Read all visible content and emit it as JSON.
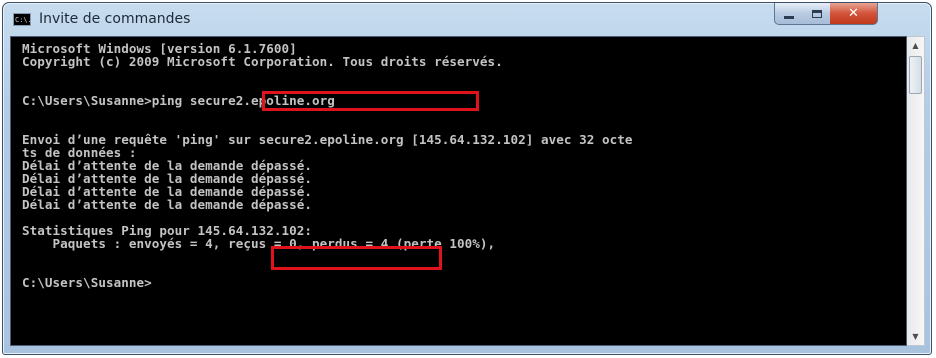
{
  "window": {
    "title": "Invite de commandes",
    "icon_text": "C:\\.",
    "icon": "cmd-icon",
    "controls": {
      "minimize_icon": "minimize-icon",
      "maximize_icon": "maximize-icon",
      "close_icon": "close-icon",
      "close_glyph": "✕"
    }
  },
  "console": {
    "lines": [
      "Microsoft Windows [version 6.1.7600]",
      "Copyright (c) 2009 Microsoft Corporation. Tous droits réservés.",
      "",
      "C:\\Users\\Susanne>ping secure2.epoline.org",
      "",
      "Envoi d’une requête 'ping' sur secure2.epoline.org [145.64.132.102] avec 32 octe",
      "ts de données :",
      "Délai d’attente de la demande dépassé.",
      "Délai d’attente de la demande dépassé.",
      "Délai d’attente de la demande dépassé.",
      "Délai d’attente de la demande dépassé.",
      "",
      "Statistiques Ping pour 145.64.132.102:",
      "    Paquets : envoyés = 4, reçus = 0, perdus = 4 (perte 100%),",
      "",
      "C:\\Users\\Susanne>"
    ],
    "text_color": "#c3c3c3",
    "background_color": "#000000",
    "highlight_color": "#e0121b"
  },
  "scrollbar": {
    "up_glyph": "▲",
    "down_glyph": "▼"
  }
}
